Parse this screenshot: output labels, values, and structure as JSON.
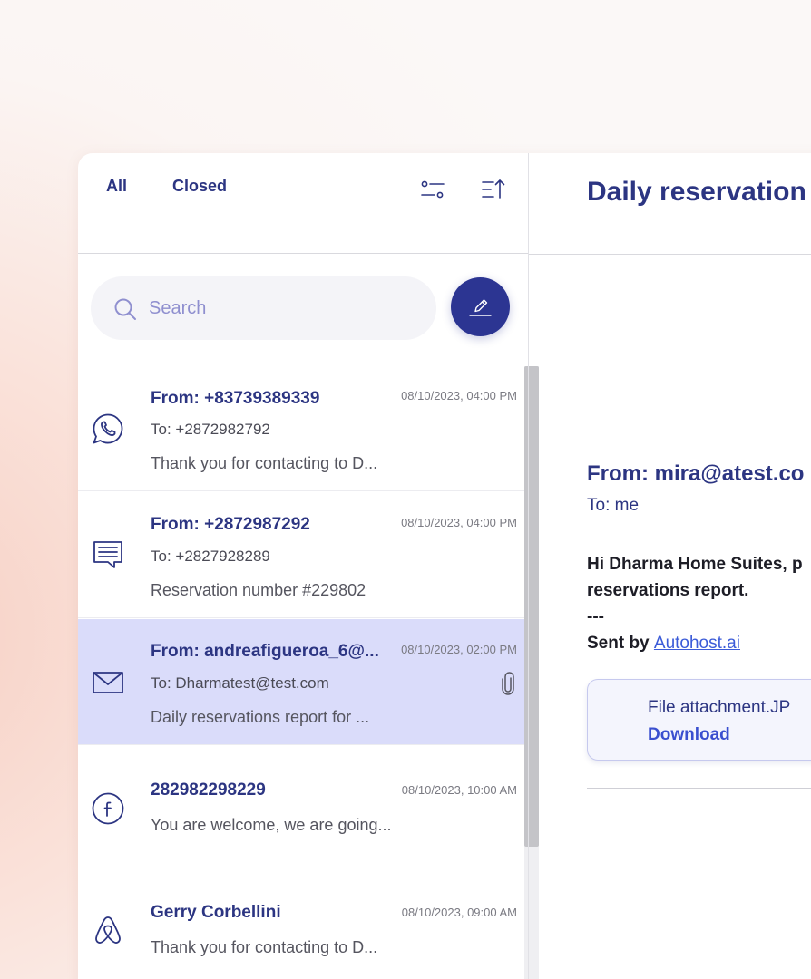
{
  "tabs": [
    {
      "label": "All"
    },
    {
      "label": "Closed"
    }
  ],
  "search": {
    "placeholder": "Search"
  },
  "conversations": [
    {
      "channel": "whatsapp-icon",
      "from": "From: +83739389339",
      "date": "08/10/2023, 04:00 PM",
      "to": "To: +2872982792",
      "preview": "Thank you for contacting to D..."
    },
    {
      "channel": "sms-icon",
      "from": "From: +2872987292",
      "date": "08/10/2023, 04:00 PM",
      "to": "To: +2827928289",
      "preview": "Reservation number #229802"
    },
    {
      "channel": "email-icon",
      "from": "From: andreafigueroa_6@...",
      "date": "08/10/2023, 02:00 PM",
      "to": "To: Dharmatest@test.com",
      "preview": "Daily reservations report for ...",
      "selected": true,
      "has_attachment": true
    },
    {
      "channel": "facebook-icon",
      "from": "282982298229",
      "date": "08/10/2023, 10:00 AM",
      "to": "",
      "preview": "You are welcome, we are going..."
    },
    {
      "channel": "airbnb-icon",
      "from": "Gerry Corbellini",
      "date": "08/10/2023, 09:00 AM",
      "to": "",
      "preview": "Thank you for contacting to D..."
    }
  ],
  "reader": {
    "subject": "Daily reservation",
    "from": "From: mira@atest.co",
    "to": "To: me",
    "body_line1": "Hi Dharma Home Suites, p",
    "body_line2": "reservations report.",
    "body_line3": "---",
    "sent_by_prefix": "Sent by",
    "sent_by_link": "Autohost.ai",
    "attachment": {
      "filename": "File attachment.JP",
      "download_label": "Download"
    }
  },
  "colors": {
    "accent": "#2c3592",
    "selected_row": "#dadcfa",
    "link": "#3b5bd8"
  }
}
